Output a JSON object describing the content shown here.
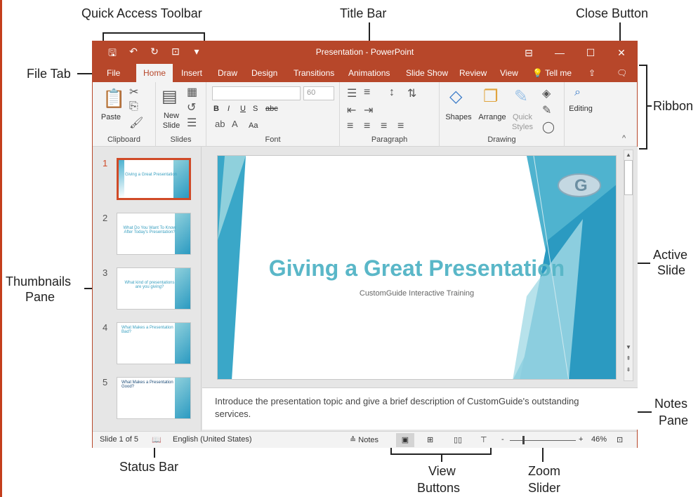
{
  "callouts": {
    "quick_access_toolbar": "Quick Access Toolbar",
    "title_bar": "Title Bar",
    "close_button": "Close Button",
    "file_tab": "File Tab",
    "ribbon": "Ribbon",
    "thumbnails_pane_1": "Thumbnails",
    "thumbnails_pane_2": "Pane",
    "active_slide_1": "Active",
    "active_slide_2": "Slide",
    "notes_pane_1": "Notes",
    "notes_pane_2": "Pane",
    "status_bar": "Status Bar",
    "view_buttons_1": "View",
    "view_buttons_2": "Buttons",
    "zoom_slider_1": "Zoom",
    "zoom_slider_2": "Slider"
  },
  "window": {
    "title": "Presentation - PowerPoint",
    "qat_icons": [
      "save-icon",
      "undo-icon",
      "redo-icon",
      "start-from-beginning-icon",
      "customize-qat-icon"
    ],
    "tabs": [
      "File",
      "Home",
      "Insert",
      "Draw",
      "Design",
      "Transitions",
      "Animations",
      "Slide Show",
      "Review",
      "View"
    ],
    "active_tab": "Home",
    "tell_me": "Tell me"
  },
  "ribbon": {
    "clipboard": {
      "label": "Clipboard",
      "paste": "Paste"
    },
    "slides": {
      "label": "Slides",
      "new_slide_1": "New",
      "new_slide_2": "Slide"
    },
    "font": {
      "label": "Font",
      "font_size": "60",
      "bold": "B",
      "italic": "I",
      "underline": "U",
      "shadow": "S",
      "strike": "abc",
      "case": "Aa"
    },
    "paragraph": {
      "label": "Paragraph"
    },
    "drawing": {
      "label": "Drawing",
      "shapes": "Shapes",
      "arrange": "Arrange",
      "quick_1": "Quick",
      "quick_2": "Styles"
    },
    "editing": {
      "label": "Editing"
    }
  },
  "thumbnails": [
    {
      "num": "1",
      "title": "Giving a Great Presentation"
    },
    {
      "num": "2",
      "title": "What Do You Want To Know After Today's Presentation?"
    },
    {
      "num": "3",
      "title": "What kind of presentations are you giving?"
    },
    {
      "num": "4",
      "title": "What Makes a Presentation Bad?"
    },
    {
      "num": "5",
      "title": "What Makes a Presentation Good?"
    }
  ],
  "slide": {
    "title": "Giving a Great Presentation",
    "subtitle": "CustomGuide Interactive Training"
  },
  "notes": {
    "text": "Introduce the presentation topic and give a brief description of CustomGuide's outstanding services."
  },
  "status": {
    "slide_of": "Slide 1 of 5",
    "language": "English (United States)",
    "notes_btn": "Notes",
    "zoom_minus": "-",
    "zoom_plus": "+",
    "zoom": "46%",
    "zoom_value": 46
  },
  "colors": {
    "accent": "#b7472a",
    "slide_title": "#5ab7c8"
  }
}
